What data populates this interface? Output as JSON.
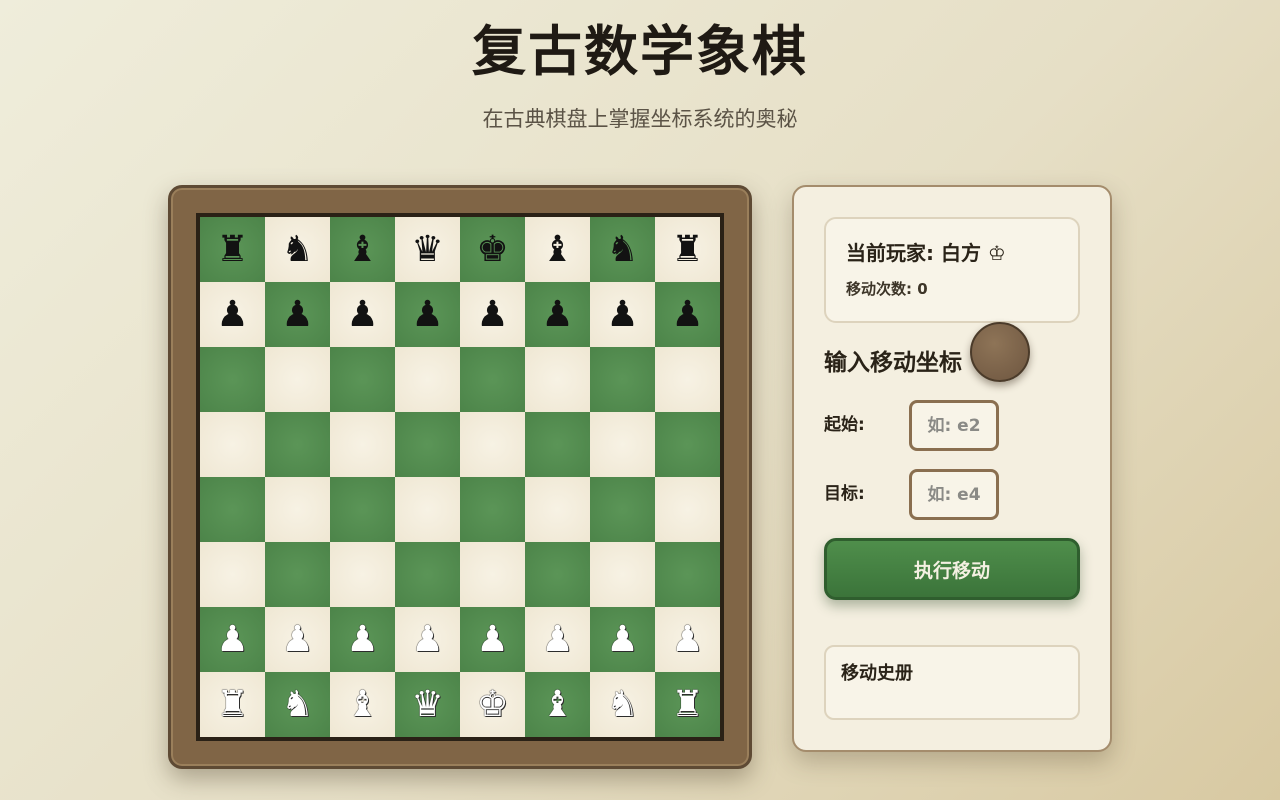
{
  "header": {
    "title": "复古数学象棋",
    "subtitle": "在古典棋盘上掌握坐标系统的奥秘"
  },
  "board": {
    "light_color": "#f4efe0",
    "dark_color": "#538d50",
    "top_square_color": "dark",
    "ranks": [
      [
        {
          "p": "♜",
          "c": "black"
        },
        {
          "p": "♞",
          "c": "black"
        },
        {
          "p": "♝",
          "c": "black"
        },
        {
          "p": "♛",
          "c": "black"
        },
        {
          "p": "♚",
          "c": "black"
        },
        {
          "p": "♝",
          "c": "black"
        },
        {
          "p": "♞",
          "c": "black"
        },
        {
          "p": "♜",
          "c": "black"
        }
      ],
      [
        {
          "p": "♟",
          "c": "black"
        },
        {
          "p": "♟",
          "c": "black"
        },
        {
          "p": "♟",
          "c": "black"
        },
        {
          "p": "♟",
          "c": "black"
        },
        {
          "p": "♟",
          "c": "black"
        },
        {
          "p": "♟",
          "c": "black"
        },
        {
          "p": "♟",
          "c": "black"
        },
        {
          "p": "♟",
          "c": "black"
        }
      ],
      [
        null,
        null,
        null,
        null,
        null,
        null,
        null,
        null
      ],
      [
        null,
        null,
        null,
        null,
        null,
        null,
        null,
        null
      ],
      [
        null,
        null,
        null,
        null,
        null,
        null,
        null,
        null
      ],
      [
        null,
        null,
        null,
        null,
        null,
        null,
        null,
        null
      ],
      [
        {
          "p": "♟",
          "c": "white"
        },
        {
          "p": "♟",
          "c": "white"
        },
        {
          "p": "♟",
          "c": "white"
        },
        {
          "p": "♟",
          "c": "white"
        },
        {
          "p": "♟",
          "c": "white"
        },
        {
          "p": "♟",
          "c": "white"
        },
        {
          "p": "♟",
          "c": "white"
        },
        {
          "p": "♟",
          "c": "white"
        }
      ],
      [
        {
          "p": "♜",
          "c": "white"
        },
        {
          "p": "♞",
          "c": "white"
        },
        {
          "p": "♝",
          "c": "white"
        },
        {
          "p": "♛",
          "c": "white"
        },
        {
          "p": "♚",
          "c": "white"
        },
        {
          "p": "♝",
          "c": "white"
        },
        {
          "p": "♞",
          "c": "white"
        },
        {
          "p": "♜",
          "c": "white"
        }
      ]
    ]
  },
  "status": {
    "current_player": "当前玩家: 白方 ♔",
    "move_count_label": "移动次数: 0"
  },
  "controls": {
    "section_title": "输入移动坐标",
    "toggle_icon": "",
    "from_label": "起始:",
    "from_placeholder": "如: e2",
    "from_value": "",
    "to_label": "目标:",
    "to_placeholder": "如: e4",
    "to_value": "",
    "execute_label": "执行移动"
  },
  "history": {
    "title": "移动史册",
    "entries": []
  }
}
